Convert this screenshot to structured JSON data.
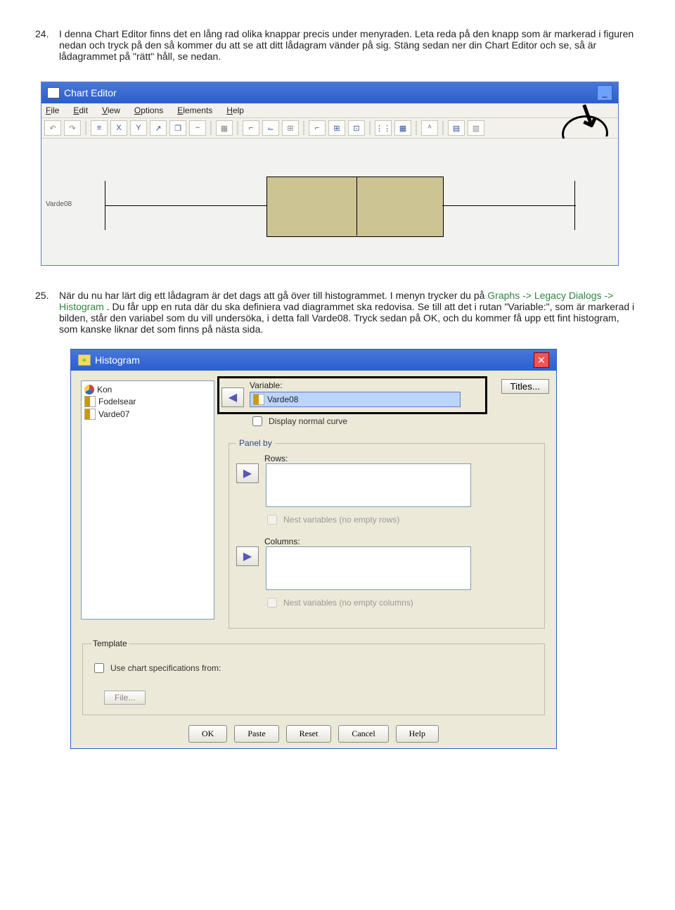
{
  "items": [
    {
      "num": "24.",
      "textA": "I denna Chart Editor finns det en lång rad olika knappar precis under menyraden. Leta reda på den knapp som är markerad i figuren nedan och tryck på den så kommer du att se att ditt lådagram vänder på sig. Stäng sedan ner din Chart Editor och se, så är lådagrammet på \"rätt\" håll, se nedan."
    },
    {
      "num": "25.",
      "textA": "När du nu har lärt dig ett lådagram är det dags att gå över till histogrammet. I menyn trycker du på ",
      "green": "Graphs -> Legacy Dialogs -> Histogram",
      "textB": ". Du får upp en ruta där du ska definiera vad diagrammet ska redovisa. Se till att det i rutan \"Variable:\", som är markerad i bilden, står den variabel som du vill undersöka, i detta fall Varde08. Tryck sedan på OK, och du kommer få upp ett fint histogram, som kanske liknar det som finns på nästa sida."
    }
  ],
  "chartEditor": {
    "title": "Chart Editor",
    "menu": [
      "File",
      "Edit",
      "View",
      "Options",
      "Elements",
      "Help"
    ],
    "axisLabel": "Varde08",
    "toolbarIcons": [
      "↶",
      "↷",
      "≡",
      "X",
      "Y",
      "↗",
      "❐",
      "~",
      "▦",
      "⌐",
      "⌙",
      "⊞",
      "⌐",
      "⊞",
      "⊡",
      "⋮⋮",
      "▦",
      "ᴬ",
      "▤",
      "▥"
    ]
  },
  "histogram": {
    "title": "Histogram",
    "sourceVars": [
      "Kon",
      "Fodelsear",
      "Varde07"
    ],
    "variableLabel": "Variable:",
    "variableValue": "Varde08",
    "displayNormal": "Display normal curve",
    "panelLegend": "Panel by",
    "rowsLabel": "Rows:",
    "nestRows": "Nest variables (no empty rows)",
    "colsLabel": "Columns:",
    "nestCols": "Nest variables (no empty columns)",
    "titlesBtn": "Titles...",
    "templateLegend": "Template",
    "templateChk": "Use chart specifications from:",
    "fileBtn": "File...",
    "buttons": [
      "OK",
      "Paste",
      "Reset",
      "Cancel",
      "Help"
    ]
  }
}
